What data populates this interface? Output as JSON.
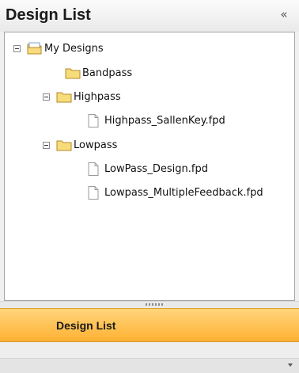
{
  "header": {
    "title": "Design List",
    "collapse_glyph": "«"
  },
  "tree": {
    "root": {
      "label": "My Designs",
      "icon": "folder-open-icon",
      "expanded": true
    },
    "folders": [
      {
        "label": "Bandpass",
        "icon": "folder-icon",
        "expanded": false,
        "files": []
      },
      {
        "label": "Highpass",
        "icon": "folder-icon",
        "expanded": true,
        "files": [
          "Highpass_SallenKey.fpd"
        ]
      },
      {
        "label": "Lowpass",
        "icon": "folder-icon",
        "expanded": true,
        "files": [
          "LowPass_Design.fpd",
          "Lowpass_MultipleFeedback.fpd"
        ]
      }
    ]
  },
  "tab": {
    "label": "Design List"
  },
  "colors": {
    "tab_top": "#ffd57c",
    "tab_bottom": "#ffb132",
    "folder": "#f7dc7a"
  }
}
